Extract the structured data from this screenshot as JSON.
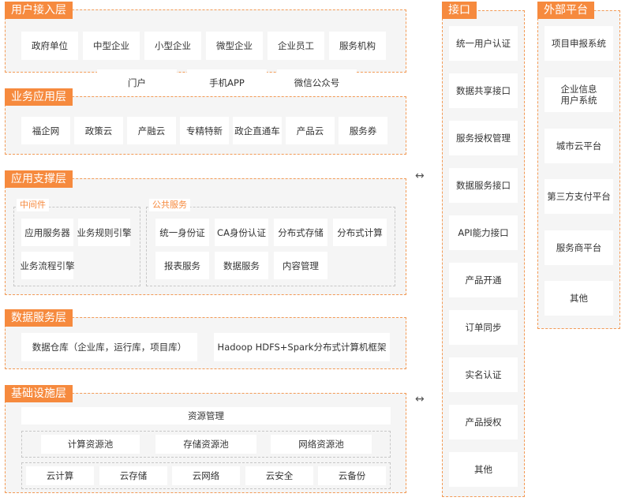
{
  "user_access": {
    "title": "用户接入层",
    "items": [
      "政府单位",
      "中型企业",
      "小型企业",
      "微型企业",
      "企业员工",
      "服务机构"
    ],
    "channels": [
      "门户",
      "手机APP",
      "微信公众号"
    ]
  },
  "business_app": {
    "title": "业务应用层",
    "items": [
      "福企网",
      "政策云",
      "产融云",
      "专精特新",
      "政企直通车",
      "产品云",
      "服务券"
    ]
  },
  "app_support": {
    "title": "应用支撑层",
    "middleware": {
      "title": "中间件",
      "items": [
        "应用服务器",
        "业务规则引擎",
        "业务流程引擎"
      ]
    },
    "public_services": {
      "title": "公共服务",
      "items": [
        "统一身份证",
        "CA身份认证",
        "分布式存储",
        "分布式计算",
        "报表服务",
        "数据服务",
        "内容管理"
      ]
    }
  },
  "data_service": {
    "title": "数据服务层",
    "items": [
      "数据仓库（企业库，运行库，项目库）",
      "Hadoop HDFS+Spark分布式计算机框架"
    ]
  },
  "infrastructure": {
    "title": "基础设施层",
    "resource_mgmt": "资源管理",
    "pools": [
      "计算资源池",
      "存储资源池",
      "网络资源池"
    ],
    "clouds": [
      "云计算",
      "云存储",
      "云网络",
      "云安全",
      "云备份"
    ]
  },
  "interface": {
    "title": "接口",
    "items": [
      "统一用户认证",
      "数据共享接口",
      "服务授权管理",
      "数据服务接口",
      "API能力接口",
      "产品开通",
      "订单同步",
      "实名认证",
      "产品授权",
      "其他"
    ]
  },
  "external": {
    "title": "外部平台",
    "items": [
      "项目申报系统",
      "企业信息\n用户系统",
      "城市云平台",
      "第三方支付平台",
      "服务商平台",
      "其他"
    ]
  },
  "connectors": {
    "symbol": "↔"
  },
  "colors": {
    "accent": "#f68a3e",
    "border": "#f39a55",
    "panel": "#f5f5f5"
  }
}
